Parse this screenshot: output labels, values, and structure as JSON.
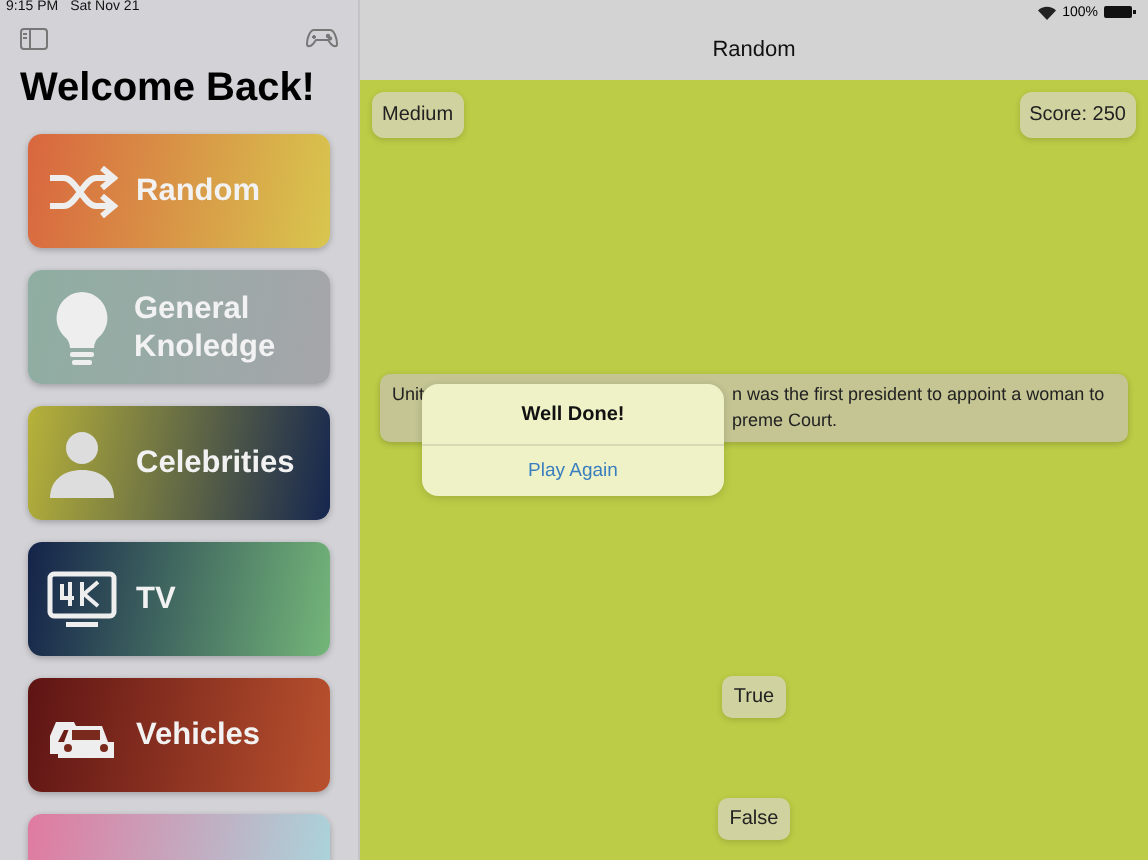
{
  "status_bar": {
    "time": "9:15 PM",
    "date": "Sat Nov 21",
    "battery": "100%"
  },
  "sidebar": {
    "title": "Welcome Back!",
    "categories": [
      {
        "kind": "full",
        "label": "Random"
      },
      {
        "kind": "full",
        "label": "General Knoledge"
      },
      {
        "kind": "full",
        "label": "Celebrities"
      },
      {
        "kind": "full",
        "label": "TV"
      },
      {
        "kind": "full",
        "label": "Vehicles"
      },
      {
        "kind": "partial"
      }
    ]
  },
  "game": {
    "title": "Random",
    "difficulty": "Medium",
    "score": "Score: 250",
    "question_parts": [
      "Unit",
      "n was the first president to appoint a woman to",
      "preme Court."
    ],
    "answers": [
      "True",
      "False"
    ],
    "alert": {
      "title": "Well Done!",
      "action": "Play Again"
    }
  }
}
